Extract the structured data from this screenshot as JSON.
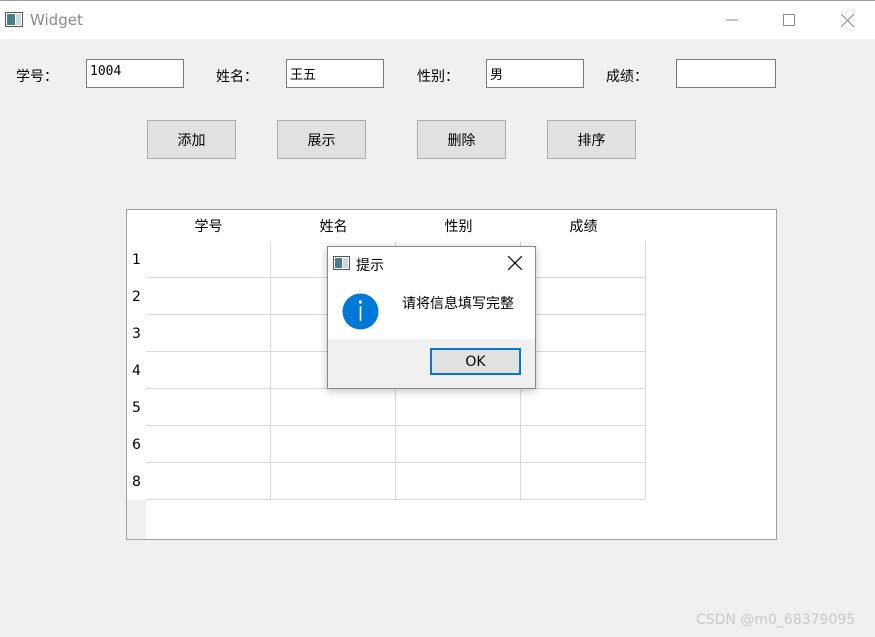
{
  "window": {
    "title": "Widget",
    "icon": "window-app-icon"
  },
  "fields": [
    {
      "label": "学号：",
      "value": "1004"
    },
    {
      "label": "姓名：",
      "value": "王五"
    },
    {
      "label": "性别：",
      "value": "男"
    },
    {
      "label": "成绩：",
      "value": ""
    }
  ],
  "buttons": {
    "add": "添加",
    "show": "展示",
    "delete": "删除",
    "sort": "排序"
  },
  "table": {
    "columns": [
      "学号",
      "姓名",
      "性别",
      "成绩"
    ],
    "row_headers": [
      "1",
      "2",
      "3",
      "4",
      "5",
      "6",
      "8"
    ]
  },
  "dialog": {
    "title": "提示",
    "message": "请将信息填写完整",
    "ok_label": "OK",
    "icon": "information-icon",
    "icon_color": "#0078d7"
  },
  "watermark": "CSDN @m0_68379095"
}
